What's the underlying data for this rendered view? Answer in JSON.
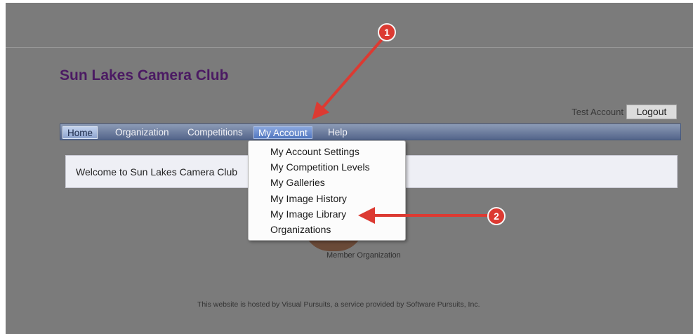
{
  "header": {
    "site_title": "Sun Lakes Camera Club",
    "user_name": "Test Account",
    "logout_label": "Logout"
  },
  "nav": {
    "items": [
      {
        "label": "Home",
        "state": "selected"
      },
      {
        "label": "Organization",
        "state": "normal"
      },
      {
        "label": "Competitions",
        "state": "normal"
      },
      {
        "label": "My Account",
        "state": "open"
      },
      {
        "label": "Help",
        "state": "normal"
      }
    ]
  },
  "dropdown": {
    "items": [
      {
        "label": "My Account Settings"
      },
      {
        "label": "My Competition Levels"
      },
      {
        "label": "My Galleries"
      },
      {
        "label": "My Image History"
      },
      {
        "label": "My Image Library"
      },
      {
        "label": "Organizations"
      }
    ]
  },
  "main": {
    "welcome_text": "Welcome to Sun Lakes Camera Club",
    "member_label": "Member Organization"
  },
  "footer": {
    "text": "This website is hosted by Visual Pursuits, a service provided by Software Pursuits, Inc."
  },
  "callouts": [
    {
      "number": "1"
    },
    {
      "number": "2"
    }
  ],
  "colors": {
    "page_bg": "#7b7b7b",
    "title": "#4b1a63",
    "callout": "#dc3a32"
  }
}
